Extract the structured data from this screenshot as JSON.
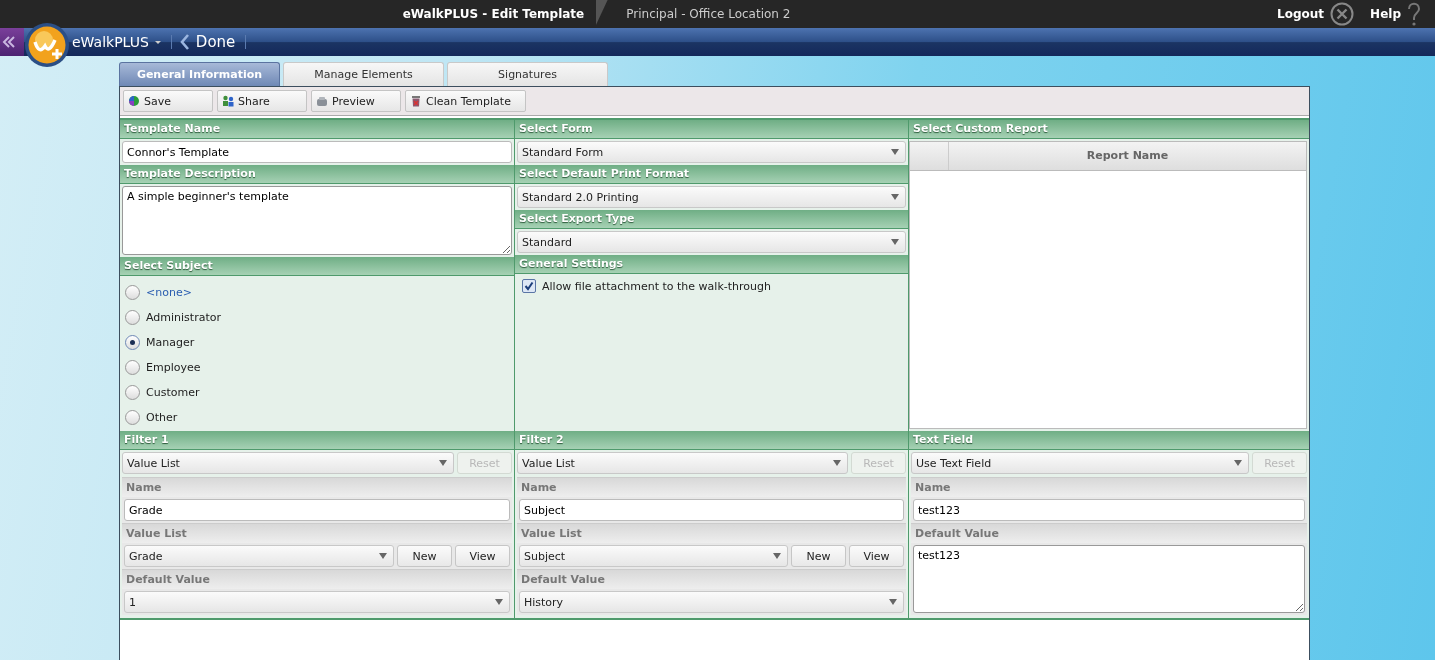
{
  "topbar": {
    "title": "eWalkPLUS - Edit Template",
    "location": "Principal - Office Location 2",
    "logout": "Logout",
    "help": "Help"
  },
  "navbar": {
    "app": "eWalkPLUS",
    "back": "Done"
  },
  "tabs": [
    {
      "label": "General Information",
      "selected": true
    },
    {
      "label": "Manage Elements",
      "selected": false
    },
    {
      "label": "Signatures",
      "selected": false
    }
  ],
  "toolbar": [
    {
      "kind": "save",
      "label": "Save"
    },
    {
      "kind": "share",
      "label": "Share"
    },
    {
      "kind": "preview",
      "label": "Preview"
    },
    {
      "kind": "clean",
      "label": "Clean Template"
    }
  ],
  "general": {
    "name_label": "Template Name",
    "name": "Connor's Template",
    "description_label": "Template Description",
    "description": "A simple beginner's template",
    "subject_label": "Select Subject",
    "subjects": [
      {
        "kind": "link",
        "label": "<none>",
        "selected": false
      },
      {
        "kind": "option",
        "label": "Administrator",
        "selected": false
      },
      {
        "kind": "option",
        "label": "Manager",
        "selected": true
      },
      {
        "kind": "option",
        "label": "Employee",
        "selected": false
      },
      {
        "kind": "option",
        "label": "Customer",
        "selected": false
      },
      {
        "kind": "option",
        "label": "Other",
        "selected": false
      }
    ],
    "selects": [
      {
        "label": "Select Form",
        "value": "Standard Form"
      },
      {
        "label": "Select Default Print Format",
        "value": "Standard 2.0 Printing"
      },
      {
        "label": "Select Export Type",
        "value": "Standard"
      }
    ],
    "settings_label": "General Settings",
    "settings": [
      {
        "label": "Allow file attachment to the walk-through",
        "checked": true
      }
    ],
    "report_label": "Select Custom Report",
    "report_column": "Report Name"
  },
  "filters": [
    {
      "kind": "value_list",
      "title": "Filter 1",
      "type": "Value List",
      "reset": "Reset",
      "reset_disabled": true,
      "name_label": "Name",
      "name": "Grade",
      "list_label": "Value List",
      "list": "Grade",
      "new": "New",
      "view": "View",
      "default_label": "Default Value",
      "default": "1"
    },
    {
      "kind": "value_list",
      "title": "Filter 2",
      "type": "Value List",
      "reset": "Reset",
      "reset_disabled": true,
      "name_label": "Name",
      "name": "Subject",
      "list_label": "Value List",
      "list": "Subject",
      "new": "New",
      "view": "View",
      "default_label": "Default Value",
      "default": "History"
    },
    {
      "kind": "text_field",
      "title": "Text Field",
      "type": "Use Text Field",
      "reset": "Reset",
      "reset_disabled": true,
      "name_label": "Name",
      "name": "test123",
      "default_label": "Default Value",
      "default": "test123"
    }
  ]
}
